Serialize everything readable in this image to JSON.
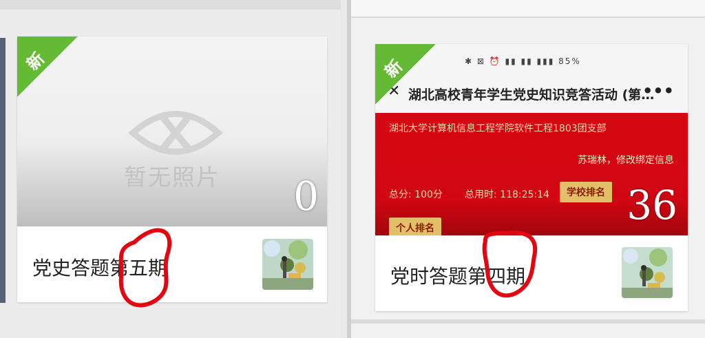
{
  "cards": [
    {
      "badge": "新",
      "title": "党史答题第五期",
      "count": "0",
      "placeholder": "暂无照片"
    },
    {
      "badge": "新",
      "title": "党时答题第四期",
      "count": "36",
      "phone": {
        "status": "✱ ⊠ ⏰ ▮▮ ▮▮ ▮▮▮ 85%",
        "header_close": "✕",
        "header_title": "湖北高校青年学生党史知识竞答活动 (第…",
        "header_more": "•••",
        "line1": "湖北大学计算机信息工程学院软件工程1803团支部",
        "line2": "苏瑞林，修改绑定信息",
        "score": "总分: 100分",
        "time": "总用时: 118:25:14",
        "school_rank": "学校排名",
        "personal_rank": "个人排名"
      }
    }
  ],
  "colors": {
    "ribbon": "#65ba34",
    "annotation": "#e10612",
    "banner_red": "#d50812"
  }
}
